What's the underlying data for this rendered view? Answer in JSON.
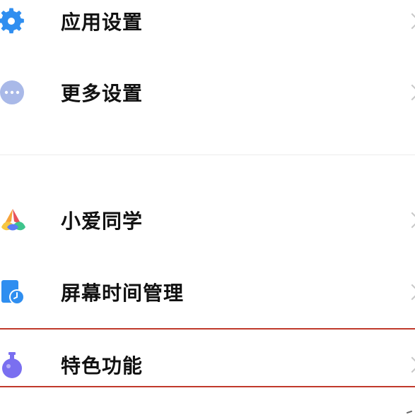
{
  "settings_list": {
    "items": [
      {
        "label": "应用设置",
        "icon": "gear-icon",
        "icon_color": "#2f8ef0"
      },
      {
        "label": "更多设置",
        "icon": "more-dots-icon",
        "icon_color": "#a9b9e8"
      },
      {
        "label": "小爱同学",
        "icon": "xiaoai-icon",
        "icon_color": "#5b7cf5"
      },
      {
        "label": "屏幕时间管理",
        "icon": "screen-time-icon",
        "icon_color": "#2f8ef0"
      },
      {
        "label": "特色功能",
        "icon": "flask-icon",
        "icon_color": "#7a6ff0"
      }
    ]
  },
  "colors": {
    "highlight_border": "#c0392b",
    "chevron": "#c8c8c8"
  }
}
